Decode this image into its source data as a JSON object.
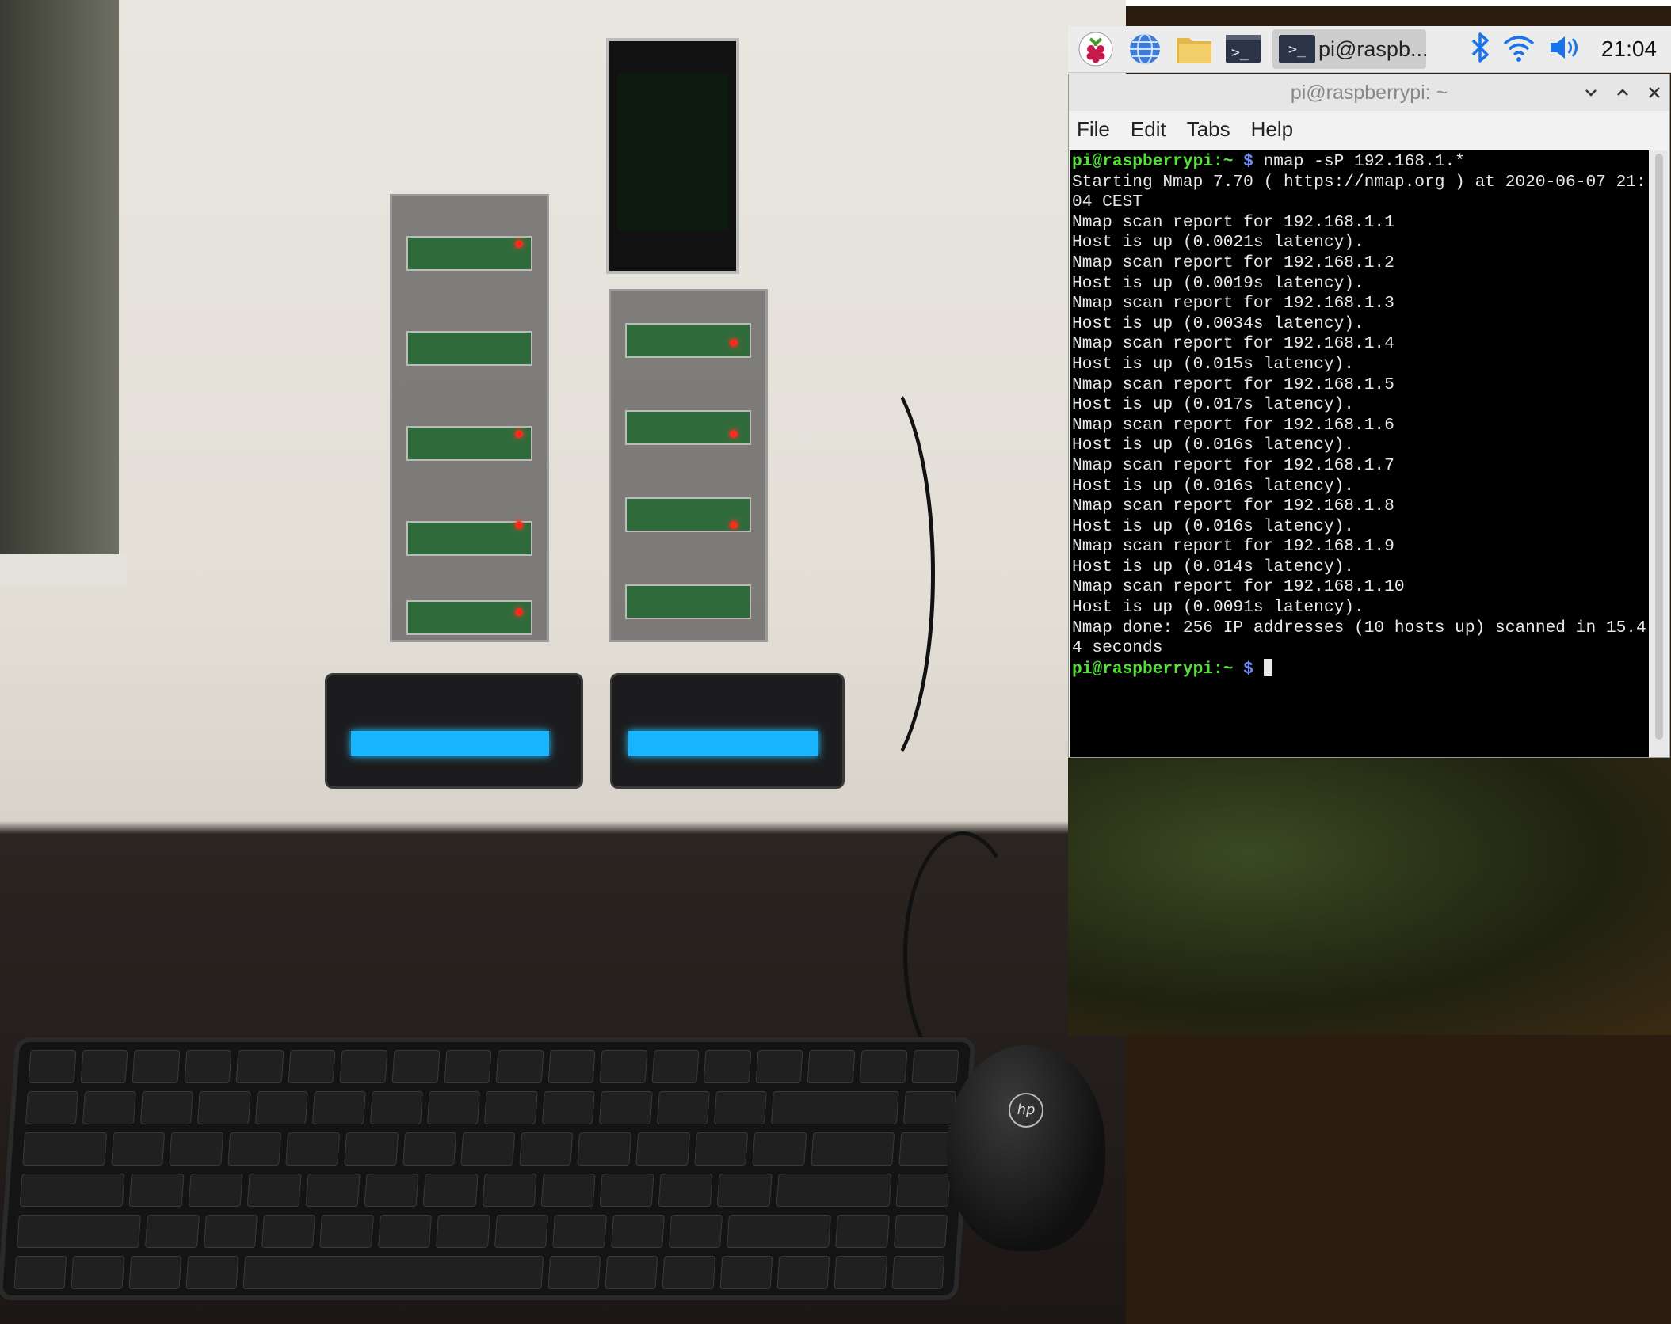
{
  "taskbar": {
    "icons": [
      "raspberry-menu-icon",
      "web-browser-icon",
      "file-manager-icon",
      "terminal-icon"
    ],
    "active_window_label": "pi@raspb...",
    "tray_icons": [
      "bluetooth-icon",
      "wifi-icon",
      "volume-icon"
    ],
    "clock": "21:04"
  },
  "window": {
    "title": "pi@raspberrypi: ~",
    "menu": [
      "File",
      "Edit",
      "Tabs",
      "Help"
    ]
  },
  "terminal": {
    "prompt": "pi@raspberrypi:~",
    "dollar": "$",
    "command": "nmap -sP 192.168.1.*",
    "output": [
      "Starting Nmap 7.70 ( https://nmap.org ) at 2020-06-07 21:",
      "04 CEST",
      "Nmap scan report for 192.168.1.1",
      "Host is up (0.0021s latency).",
      "Nmap scan report for 192.168.1.2",
      "Host is up (0.0019s latency).",
      "Nmap scan report for 192.168.1.3",
      "Host is up (0.0034s latency).",
      "Nmap scan report for 192.168.1.4",
      "Host is up (0.015s latency).",
      "Nmap scan report for 192.168.1.5",
      "Host is up (0.017s latency).",
      "Nmap scan report for 192.168.1.6",
      "Host is up (0.016s latency).",
      "Nmap scan report for 192.168.1.7",
      "Host is up (0.016s latency).",
      "Nmap scan report for 192.168.1.8",
      "Host is up (0.016s latency).",
      "Nmap scan report for 192.168.1.9",
      "Host is up (0.014s latency).",
      "Nmap scan report for 192.168.1.10",
      "Host is up (0.0091s latency).",
      "Nmap done: 256 IP addresses (10 hosts up) scanned in 15.4",
      "4 seconds"
    ]
  },
  "photo": {
    "mouse_logo": "hp"
  },
  "colors": {
    "prompt_green": "#56e03a",
    "dollar_blue": "#6f8cff",
    "bluetooth_blue": "#1a73e8",
    "taskbar_bg": "#ececec"
  }
}
